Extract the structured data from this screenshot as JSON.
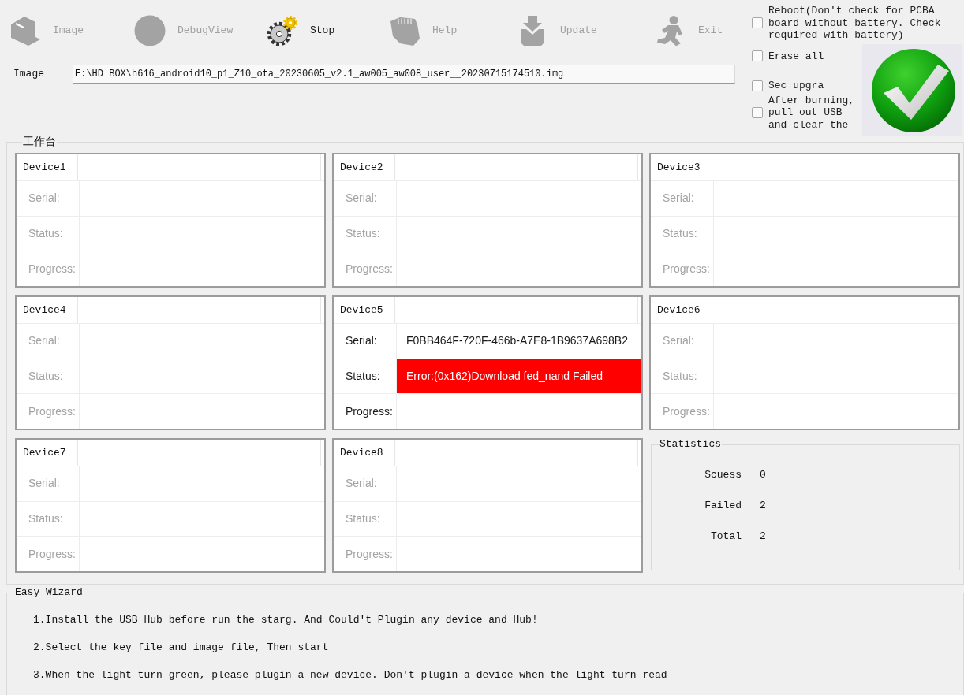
{
  "toolbar": [
    {
      "label": "Image",
      "disabled": true
    },
    {
      "label": "DebugView",
      "disabled": true
    },
    {
      "label": "Stop",
      "disabled": false
    },
    {
      "label": "Help",
      "disabled": true
    },
    {
      "label": "Update",
      "disabled": true
    },
    {
      "label": "Exit",
      "disabled": true
    }
  ],
  "image_field": {
    "label": "Image",
    "value": "E:\\HD BOX\\h616_android10_p1_Z10_ota_20230605_v2.1_aw005_aw008_user__20230715174510.img"
  },
  "options": [
    {
      "label": "Reboot(Don't check for PCBA board without battery. Check required with battery)",
      "checked": false
    },
    {
      "label": "Erase all",
      "checked": false
    },
    {
      "label": "Sec upgra",
      "checked": false
    },
    {
      "label": "After burning, pull out USB and clear the",
      "checked": false
    }
  ],
  "workbench": {
    "title": "工作台",
    "devices": [
      {
        "name": "Device1",
        "disabled": true,
        "rows": [
          {
            "label": "Serial:",
            "error": false
          },
          {
            "label": "Status:",
            "error": false
          },
          {
            "label": "Progress:",
            "error": false
          }
        ]
      },
      {
        "name": "Device2",
        "disabled": true,
        "rows": [
          {
            "label": "Serial:",
            "error": false
          },
          {
            "label": "Status:",
            "error": false
          },
          {
            "label": "Progress:",
            "error": false
          }
        ]
      },
      {
        "name": "Device3",
        "disabled": true,
        "rows": [
          {
            "label": "Serial:",
            "error": false
          },
          {
            "label": "Status:",
            "error": false
          },
          {
            "label": "Progress:",
            "error": false
          }
        ]
      },
      {
        "name": "Device4",
        "disabled": true,
        "rows": [
          {
            "label": "Serial:",
            "error": false
          },
          {
            "label": "Status:",
            "error": false
          },
          {
            "label": "Progress:",
            "error": false
          }
        ]
      },
      {
        "name": "Device5",
        "disabled": false,
        "rows": [
          {
            "label": "Serial:",
            "value": "F0BB464F-720F-466b-A7E8-1B9637A698B2",
            "error": false
          },
          {
            "label": "Status:",
            "value": "Error:(0x162)Download fed_nand Failed",
            "error": true
          },
          {
            "label": "Progress:",
            "error": false
          }
        ]
      },
      {
        "name": "Device6",
        "disabled": true,
        "rows": [
          {
            "label": "Serial:",
            "error": false
          },
          {
            "label": "Status:",
            "error": false
          },
          {
            "label": "Progress:",
            "error": false
          }
        ]
      },
      {
        "name": "Device7",
        "disabled": true,
        "rows": [
          {
            "label": "Serial:",
            "error": false
          },
          {
            "label": "Status:",
            "error": false
          },
          {
            "label": "Progress:",
            "error": false
          }
        ]
      },
      {
        "name": "Device8",
        "disabled": true,
        "rows": [
          {
            "label": "Serial:",
            "error": false
          },
          {
            "label": "Status:",
            "error": false
          },
          {
            "label": "Progress:",
            "error": false
          }
        ]
      }
    ],
    "statistics": {
      "title": "Statistics",
      "rows": [
        {
          "label": "Scuess",
          "value": "0"
        },
        {
          "label": "Failed",
          "value": "2"
        },
        {
          "label": "Total",
          "value": "2"
        }
      ]
    }
  },
  "wizard": {
    "title": "Easy Wizard",
    "steps": [
      "1.Install the USB Hub before run the starg. And Could't Plugin any device and Hub!",
      "2.Select the key file and image file, Then start",
      "3.When the light turn green, please plugin a new device. Don't plugin a device when the light turn read"
    ]
  }
}
